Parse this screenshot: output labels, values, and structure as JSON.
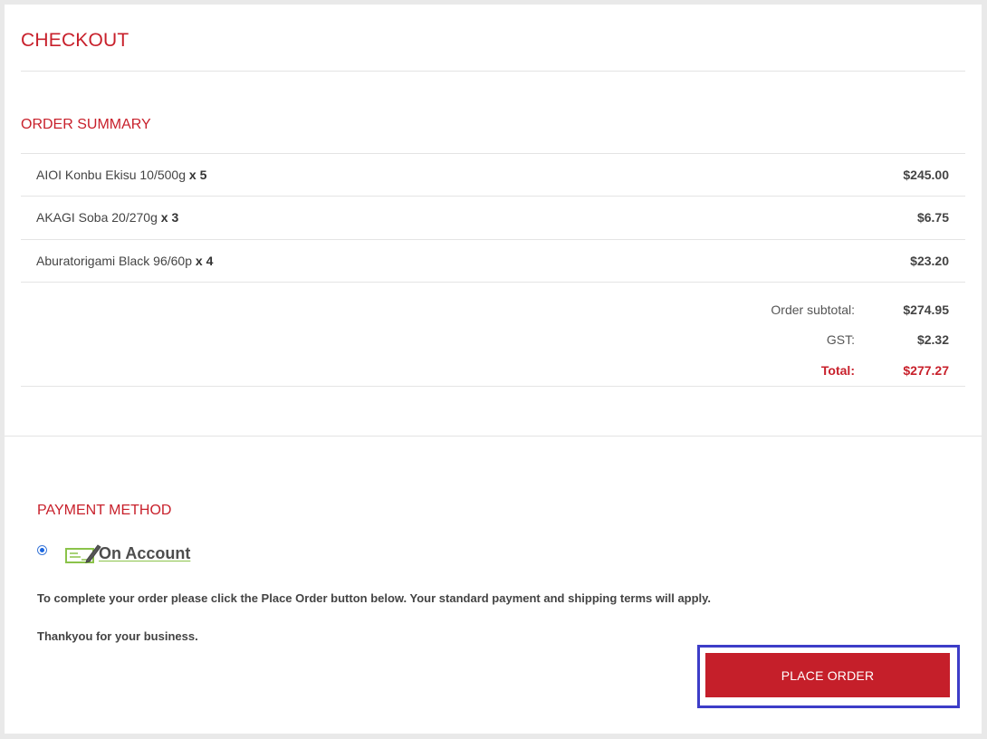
{
  "page": {
    "title": "CHECKOUT"
  },
  "order_summary": {
    "title": "ORDER SUMMARY",
    "items": [
      {
        "name": "AIOI Konbu Ekisu 10/500g",
        "qty": "x 5",
        "price": "$245.00"
      },
      {
        "name": "AKAGI Soba 20/270g",
        "qty": "x 3",
        "price": "$6.75"
      },
      {
        "name": "Aburatorigami Black 96/60p",
        "qty": "x 4",
        "price": "$23.20"
      }
    ],
    "subtotal_label": "Order subtotal:",
    "subtotal_value": "$274.95",
    "gst_label": "GST:",
    "gst_value": "$2.32",
    "total_label": "Total:",
    "total_value": "$277.27"
  },
  "payment": {
    "title": "PAYMENT METHOD",
    "method_label": "On Account",
    "method_icon": "cheque-pen-icon",
    "selected": true,
    "instructions": "To complete your order please click the Place Order button below. Your standard payment and shipping terms will apply.",
    "thanks": "Thankyou for your business."
  },
  "actions": {
    "place_order_label": "PLACE ORDER"
  },
  "colors": {
    "accent": "#c8202b",
    "button": "#c51f2a",
    "focus_ring": "#3d3dc8",
    "logo_green": "#8bc34a"
  }
}
